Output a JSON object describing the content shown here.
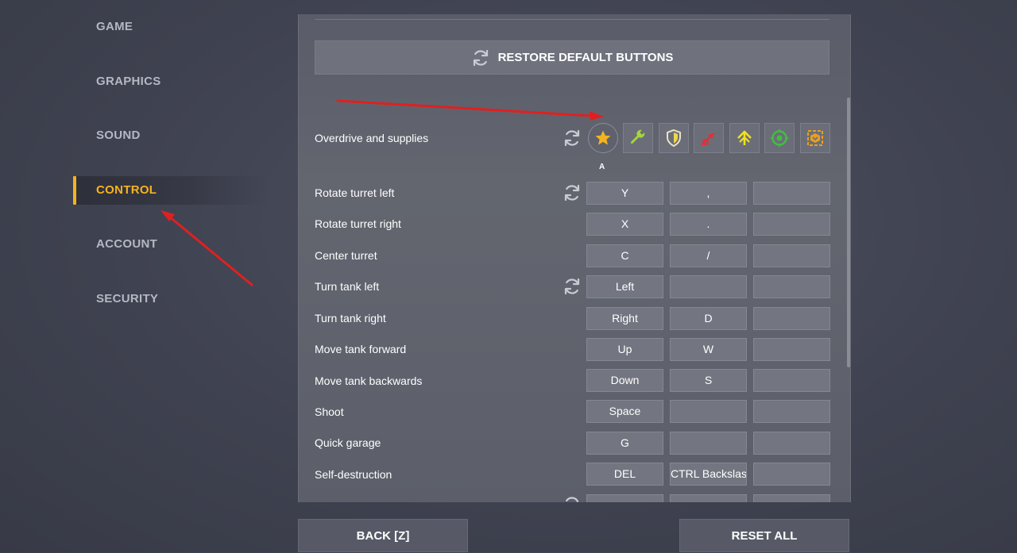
{
  "sidebar": {
    "items": [
      {
        "label": "GAME"
      },
      {
        "label": "GRAPHICS"
      },
      {
        "label": "SOUND"
      },
      {
        "label": "CONTROL",
        "active": true
      },
      {
        "label": "ACCOUNT"
      },
      {
        "label": "SECURITY"
      }
    ]
  },
  "panel": {
    "restore_label": "RESTORE DEFAULT BUTTONS",
    "supplies_label": "Overdrive and supplies",
    "supplies_key": "A",
    "supplies_icons": [
      "star-icon",
      "wrench-icon",
      "shield-icon",
      "damage-icon",
      "speed-boost-icon",
      "mine-icon",
      "gold-box-icon"
    ],
    "bindings": [
      {
        "action": "Rotate turret left",
        "keys": [
          "Y",
          ",",
          ""
        ]
      },
      {
        "action": "Rotate turret right",
        "keys": [
          "X",
          ".",
          ""
        ]
      },
      {
        "action": "Center turret",
        "keys": [
          "C",
          "/",
          ""
        ]
      },
      {
        "action": "Turn tank left",
        "keys": [
          "Left",
          "",
          ""
        ]
      },
      {
        "action": "Turn tank right",
        "keys": [
          "Right",
          "D",
          ""
        ]
      },
      {
        "action": "Move tank forward",
        "keys": [
          "Up",
          "W",
          ""
        ]
      },
      {
        "action": "Move tank backwards",
        "keys": [
          "Down",
          "S",
          ""
        ]
      },
      {
        "action": "Shoot",
        "keys": [
          "Space",
          "",
          ""
        ]
      },
      {
        "action": "Quick garage",
        "keys": [
          "G",
          "",
          ""
        ]
      },
      {
        "action": "Self-destruction",
        "keys": [
          "DEL",
          "CTRL Backslash",
          ""
        ]
      }
    ]
  },
  "footer": {
    "back_label": "BACK [Z]",
    "reset_all_label": "RESET ALL"
  },
  "colors": {
    "accent": "#f5b320",
    "annotation_arrow": "#e02020"
  }
}
